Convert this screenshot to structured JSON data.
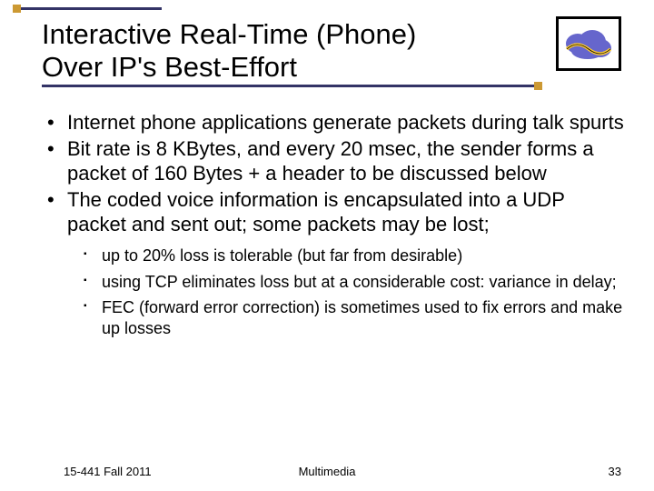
{
  "title": {
    "line1": "Interactive Real-Time (Phone)",
    "line2": "Over IP's Best-Effort"
  },
  "bullets": [
    "Internet phone applications generate packets during talk spurts",
    "Bit rate is 8 KBytes, and every 20 msec, the sender forms a packet of 160 Bytes + a header to be discussed below",
    "The coded voice information is encapsulated into a UDP packet and sent out; some packets may be lost;"
  ],
  "sub_bullets": [
    "up to 20% loss is tolerable (but far from desirable)",
    "using TCP eliminates loss but at a considerable cost: variance in delay;",
    "FEC (forward error correction) is sometimes used to fix errors and make up losses"
  ],
  "footer": {
    "left": "15-441 Fall 2011",
    "center": "Multimedia",
    "right": "33"
  },
  "colors": {
    "accent_dark": "#333366",
    "accent_gold": "#cc9933",
    "cloud": "#6666cc",
    "wave": "#ffcc33"
  }
}
